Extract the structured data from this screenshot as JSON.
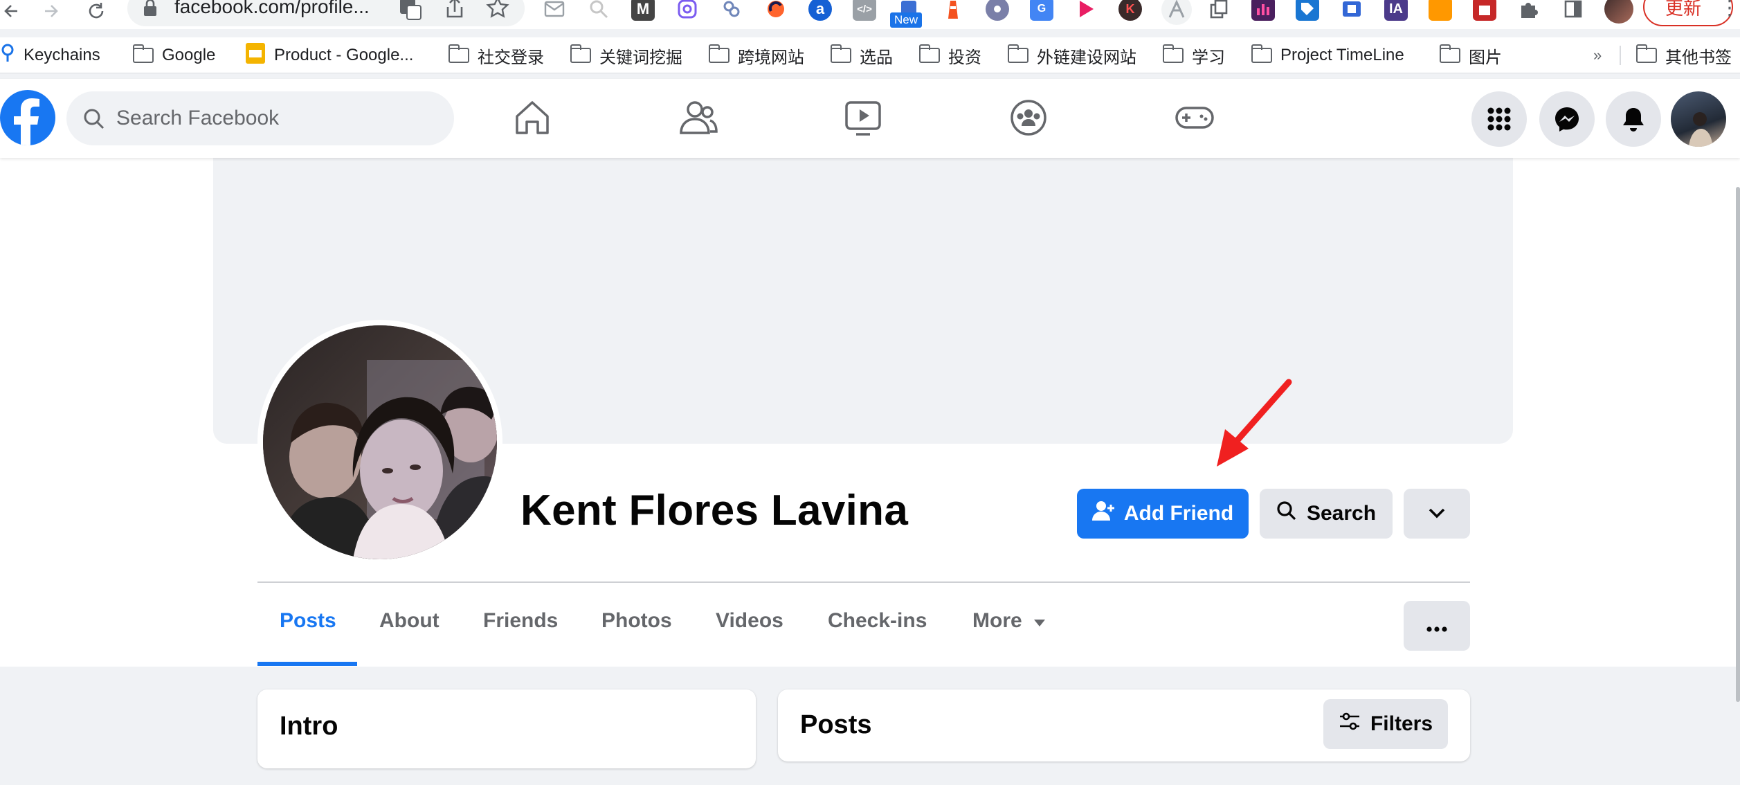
{
  "browser": {
    "url": "facebook.com/profile...",
    "new_badge": "New",
    "update_label": "更新",
    "bookmarks_overflow": "»",
    "bookmarks": [
      {
        "label": "Keychains",
        "icon": "keychain-icon"
      },
      {
        "label": "Google",
        "icon": "folder-icon"
      },
      {
        "label": "Product - Google...",
        "icon": "slides-icon"
      },
      {
        "label": "社交登录",
        "icon": "folder-icon"
      },
      {
        "label": "关键词挖掘",
        "icon": "folder-icon"
      },
      {
        "label": "跨境网站",
        "icon": "folder-icon"
      },
      {
        "label": "选品",
        "icon": "folder-icon"
      },
      {
        "label": "投资",
        "icon": "folder-icon"
      },
      {
        "label": "外链建设网站",
        "icon": "folder-icon"
      },
      {
        "label": "学习",
        "icon": "folder-icon"
      },
      {
        "label": "Project TimeLine",
        "icon": "folder-icon"
      },
      {
        "label": "图片",
        "icon": "folder-icon"
      },
      {
        "label": "其他书签",
        "icon": "folder-icon"
      }
    ]
  },
  "fb": {
    "search_placeholder": "Search Facebook",
    "brand_color": "#1877f2"
  },
  "profile": {
    "name": "Kent Flores Lavina",
    "add_friend_label": "Add Friend",
    "search_label": "Search"
  },
  "tabs": [
    {
      "label": "Posts",
      "active": true
    },
    {
      "label": "About"
    },
    {
      "label": "Friends"
    },
    {
      "label": "Photos"
    },
    {
      "label": "Videos"
    },
    {
      "label": "Check-ins"
    },
    {
      "label": "More"
    }
  ],
  "intro": {
    "title": "Intro"
  },
  "posts": {
    "title": "Posts",
    "filters_label": "Filters"
  }
}
